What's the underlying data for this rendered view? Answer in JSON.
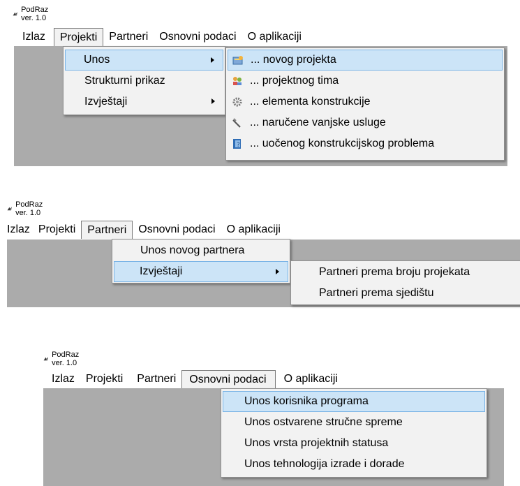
{
  "app_title": "PodRaz ver. 1.0",
  "menubar": {
    "izlaz": "Izlaz",
    "projekti": "Projekti",
    "partneri": "Partneri",
    "osnovni_podaci": "Osnovni podaci",
    "o_aplikaciji": "O aplikaciji"
  },
  "projekti_menu": {
    "unos": "Unos",
    "strukturni_prikaz": "Strukturni prikaz",
    "izvjestaji": "Izvještaji"
  },
  "unos_submenu": [
    {
      "label": "... novog projekta",
      "icon": "new-project-icon"
    },
    {
      "label": "... projektnog tima",
      "icon": "team-icon"
    },
    {
      "label": "... elementa konstrukcije",
      "icon": "gear-icon"
    },
    {
      "label": "... naručene vanjske usluge",
      "icon": "tools-icon"
    },
    {
      "label": "... uočenog konstrukcijskog problema",
      "icon": "help-book-icon"
    }
  ],
  "partneri_menu": {
    "unos_novog_partnera": "Unos novog partnera",
    "izvjestaji": "Izvještaji"
  },
  "partneri_izvjestaji_submenu": [
    "Partneri prema broju projekata",
    "Partneri prema sjedištu"
  ],
  "osnovni_podaci_menu": [
    "Unos korisnika programa",
    "Unos ostvarene stručne spreme",
    "Unos vrsta projektnih statusa",
    "Unos tehnologija izrade i dorade"
  ],
  "colors": {
    "client_area": "#ababab",
    "menu_bg": "#f2f2f2",
    "highlight_bg": "#cce4f7",
    "highlight_border": "#7ab4e6"
  }
}
